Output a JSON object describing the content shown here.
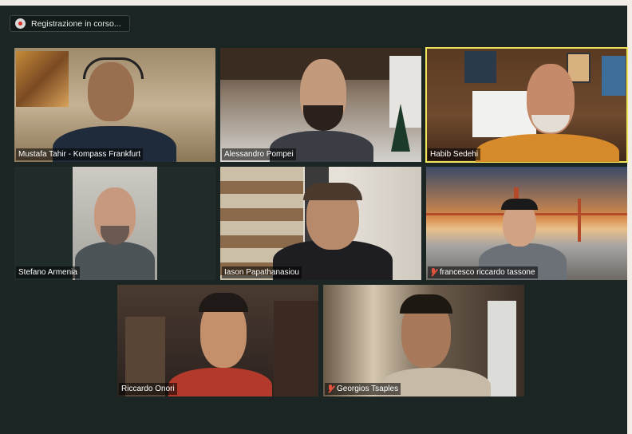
{
  "recording": {
    "label": "Registrazione in corso..."
  },
  "participants": [
    {
      "name": "Mustafa Tahir - Kompass Frankfurt",
      "muted": false,
      "active": false
    },
    {
      "name": "Alessandro Pompei",
      "muted": false,
      "active": false
    },
    {
      "name": "Habib Sedehi",
      "muted": false,
      "active": true
    },
    {
      "name": "Stefano Armenia",
      "muted": false,
      "active": false
    },
    {
      "name": "Iason Papathanasiou",
      "muted": false,
      "active": false
    },
    {
      "name": "francesco riccardo tassone",
      "muted": true,
      "active": false
    },
    {
      "name": "Riccardo Onori",
      "muted": false,
      "active": false
    },
    {
      "name": "Georgios Tsaples",
      "muted": true,
      "active": false
    }
  ],
  "colors": {
    "stage": "#1b2624",
    "active_border": "#f2e45a",
    "muted_icon": "#e0533c"
  }
}
